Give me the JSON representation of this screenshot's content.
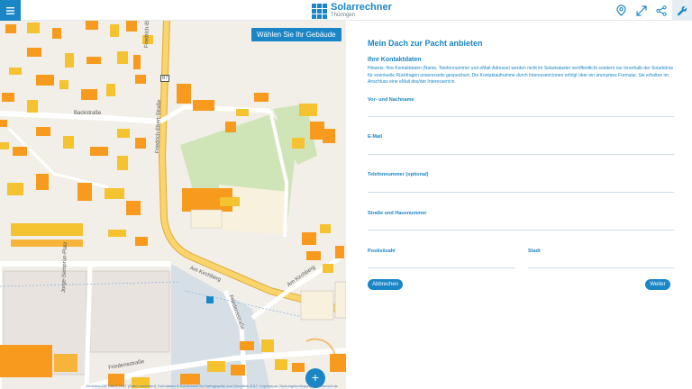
{
  "header": {
    "menu_icon": "hamburger-icon",
    "logo_name": "Solarrechner",
    "logo_region": "Thüringen",
    "icons": [
      "location-pin-icon",
      "expand-icon",
      "share-icon",
      "wrench-icon"
    ],
    "accent": "#1a86c6"
  },
  "map": {
    "select_building_label": "Wählen Sie Ihr Gebäude",
    "streets": {
      "backstrasse": "Backstraße",
      "friedrich_ebert_top": "Friedrich-Ebert-Straße",
      "friedrich_ebert_mid": "Friedrich-Ebert-Straße",
      "b7": "B7",
      "am_kirchberg": "Am Kirchberg",
      "am_kirchberg_2": "Am Kirchberg",
      "friedensstrasse": "Friedensstraße",
      "jorge_semprun": "Jorge-Semprún-Platz",
      "friedensstr_diag": "Friedensstraße"
    },
    "attribution": "Geobasis-DE / BKG 2017 (Daten verändert), Kartodaten © Bundesamt für Kartographie und Geodäsie 2017, Impressum, Nutzungsbedingungen, Datenschutz",
    "zoom_in": "+",
    "colors": {
      "building_orange": "#f79a1e",
      "building_yellow": "#f5c230",
      "green": "#cfe5b8",
      "road": "#f7d06b"
    }
  },
  "form": {
    "title": "Mein Dach zur Pacht anbieten",
    "section_title": "Ihre Kontaktdaten",
    "note": "Hinweis: Ihre Kontaktdaten (Name, Telefonnummer und eMail-Adresse) werden nicht im Solarkataster veröffentlicht sondern nur innerhalb der Solarbörse für eventuelle Rückfragen unsererseits gespeichert. Die Kontaktaufnahme durch Interessent:innen erfolgt über ein anonymes Formular. Sie erhalten im Anschluss eine eMail des/der Interessent:in.",
    "fields": {
      "name": "Vor- und Nachname",
      "email": "E-Mail",
      "phone": "Telefonnummer (optional)",
      "street": "Straße und Hausnummer",
      "zip": "Postleitzahl",
      "city": "Stadt"
    },
    "cancel_label": "Abbrechen",
    "next_label": "Weiter"
  }
}
